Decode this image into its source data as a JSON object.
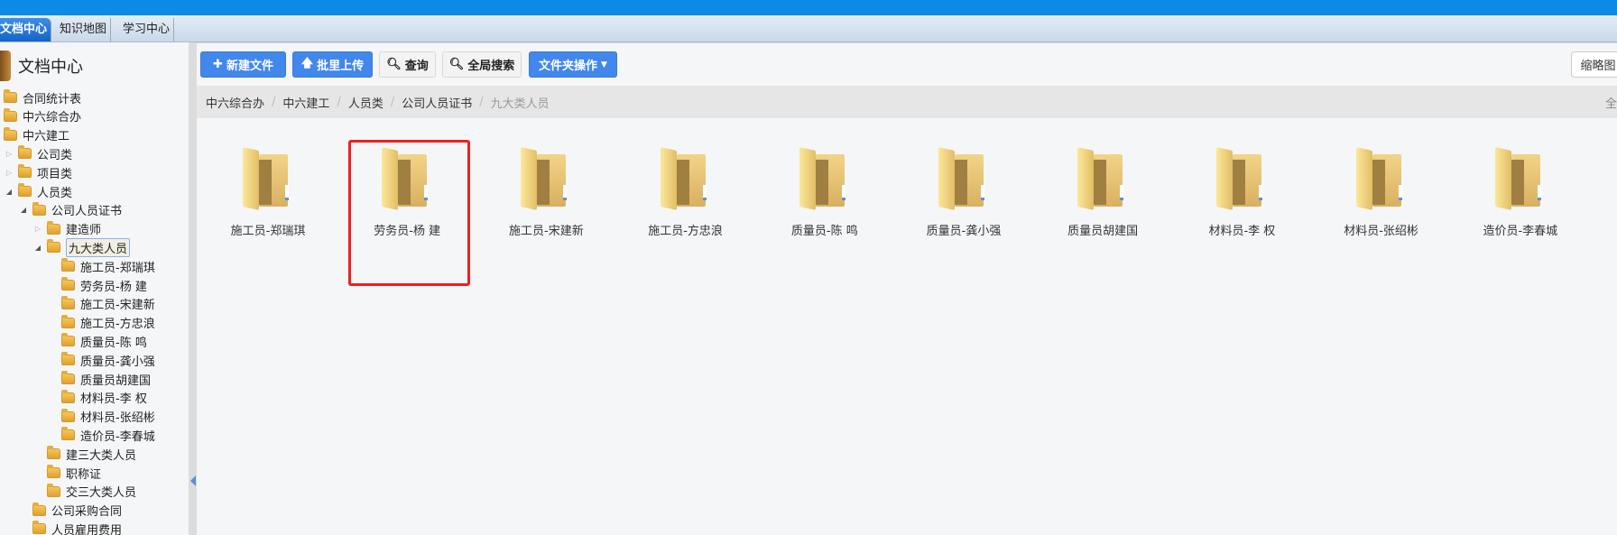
{
  "tabs": [
    "文档中心",
    "知识地图",
    "学习中心"
  ],
  "sidebar": {
    "title": "文档中心",
    "tree": [
      {
        "label": "合同统计表",
        "level": 0,
        "toggle": ""
      },
      {
        "label": "中六综合办",
        "level": 0,
        "toggle": ""
      },
      {
        "label": "中六建工",
        "level": 0,
        "toggle": "open"
      },
      {
        "label": "公司类",
        "level": 1,
        "toggle": "closed"
      },
      {
        "label": "项目类",
        "level": 1,
        "toggle": "closed"
      },
      {
        "label": "人员类",
        "level": 1,
        "toggle": "open"
      },
      {
        "label": "公司人员证书",
        "level": 2,
        "toggle": "open"
      },
      {
        "label": "建造师",
        "level": 3,
        "toggle": "closed"
      },
      {
        "label": "九大类人员",
        "level": 3,
        "toggle": "open",
        "selected": true
      },
      {
        "label": "施工员-郑瑞琪",
        "level": 4,
        "toggle": ""
      },
      {
        "label": "劳务员-杨 建",
        "level": 4,
        "toggle": ""
      },
      {
        "label": "施工员-宋建新",
        "level": 4,
        "toggle": ""
      },
      {
        "label": "施工员-方忠浪",
        "level": 4,
        "toggle": ""
      },
      {
        "label": "质量员-陈 鸣",
        "level": 4,
        "toggle": ""
      },
      {
        "label": "质量员-龚小强",
        "level": 4,
        "toggle": ""
      },
      {
        "label": "质量员胡建国",
        "level": 4,
        "toggle": ""
      },
      {
        "label": "材料员-李 权",
        "level": 4,
        "toggle": ""
      },
      {
        "label": "材料员-张绍彬",
        "level": 4,
        "toggle": ""
      },
      {
        "label": "造价员-李春城",
        "level": 4,
        "toggle": ""
      },
      {
        "label": "建三大类人员",
        "level": 3,
        "toggle": ""
      },
      {
        "label": "职称证",
        "level": 3,
        "toggle": ""
      },
      {
        "label": "交三大类人员",
        "level": 3,
        "toggle": ""
      },
      {
        "label": "公司采购合同",
        "level": 2,
        "toggle": ""
      },
      {
        "label": "人员雇用费用",
        "level": 2,
        "toggle": ""
      }
    ]
  },
  "toolbar": {
    "new_file": "新建文件",
    "batch_upload": "批里上传",
    "query": "查询",
    "global_search": "全局搜索",
    "folder_ops": "文件夹操作",
    "thumbnail": "缩略图"
  },
  "breadcrumb": {
    "items": [
      "中六综合办",
      "中六建工",
      "人员类",
      "公司人员证书"
    ],
    "current": "九大类人员",
    "right": "全"
  },
  "folders": [
    "施工员-郑瑞琪",
    "劳务员-杨 建",
    "施工员-宋建新",
    "施工员-方忠浪",
    "质量员-陈 鸣",
    "质量员-龚小强",
    "质量员胡建国",
    "材料员-李 权",
    "材料员-张绍彬",
    "造价员-李春城"
  ],
  "highlighted_folder": "劳务员-杨 建"
}
